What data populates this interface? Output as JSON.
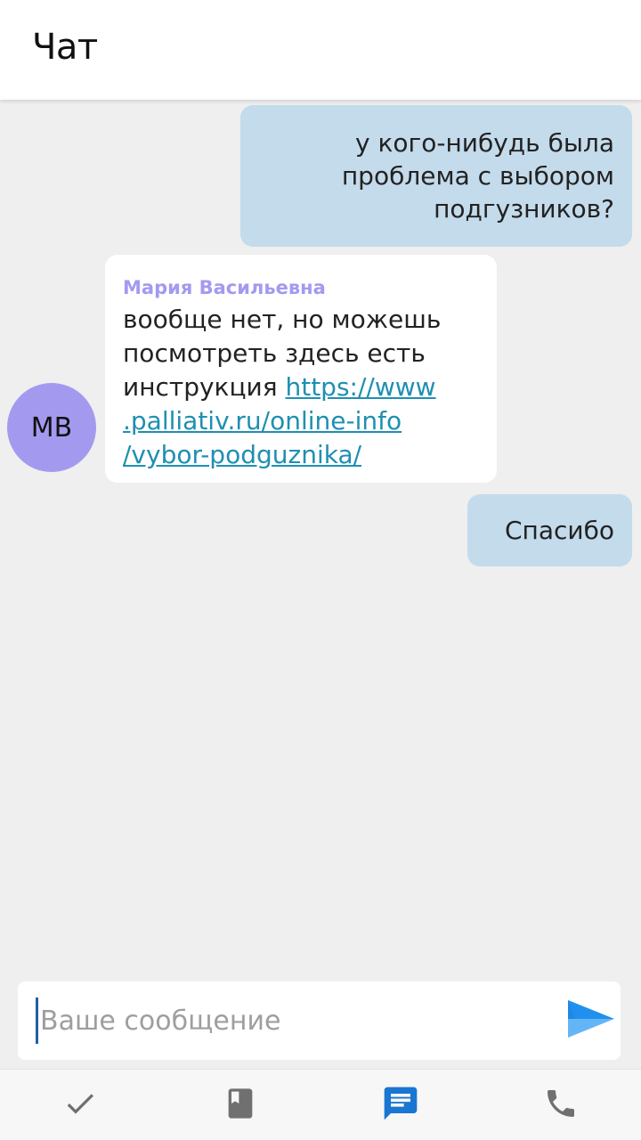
{
  "header": {
    "title": "Чат"
  },
  "messages": [
    {
      "direction": "outgoing",
      "text": "у кого-нибудь была\nпроблема с выбором\nподгузников?"
    },
    {
      "direction": "incoming",
      "sender": "Мария Васильевна",
      "avatar_initials": "МВ",
      "text": "вообще нет, но можешь посмотреть здесь есть инструкция ",
      "link_line1": "https://www",
      "link_line2": ".palliativ.ru/online-info",
      "link_line3": "/vybor-podguznika/"
    },
    {
      "direction": "outgoing",
      "text": "Спасибо"
    }
  ],
  "composer": {
    "placeholder": "Ваше сообщение",
    "value": ""
  },
  "nav": {
    "items": [
      {
        "icon": "check-icon",
        "active": false
      },
      {
        "icon": "book-icon",
        "active": false
      },
      {
        "icon": "chat-icon",
        "active": true
      },
      {
        "icon": "phone-icon",
        "active": false
      }
    ]
  },
  "colors": {
    "outgoing_bubble": "#c4dbec",
    "incoming_bubble": "#ffffff",
    "avatar_bg": "#a39af0",
    "sender_name": "#a39af0",
    "link": "#1f8fb2",
    "nav_active": "#1976d2",
    "nav_inactive": "#707070",
    "send_icon": "#2196f3"
  }
}
